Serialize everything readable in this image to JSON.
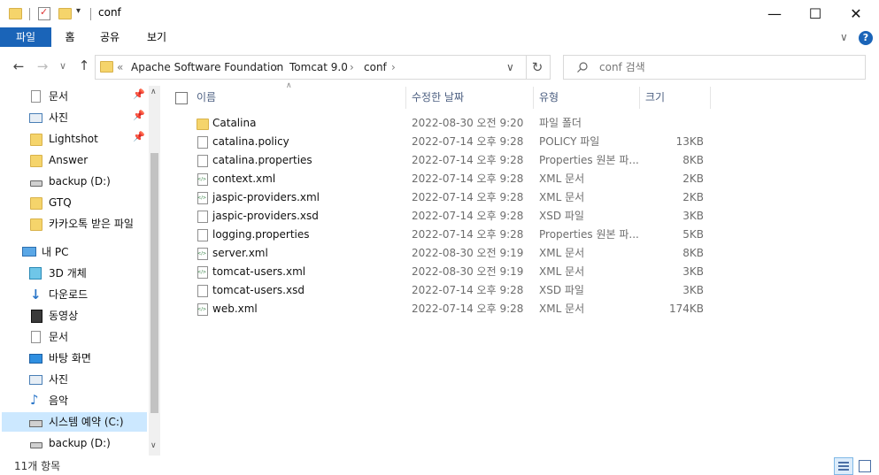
{
  "window": {
    "title": "conf",
    "minimize": "—",
    "maximize": "☐",
    "close": "✕",
    "quick_access_dropdown": "▾"
  },
  "ribbon": {
    "tabs": [
      "파일",
      "홈",
      "공유",
      "보기"
    ],
    "expand_chevron": "∨",
    "help": "?"
  },
  "navigation": {
    "back": "←",
    "forward": "→",
    "history": "∨",
    "up": "↑",
    "address_overflow": "«",
    "breadcrumb": [
      "Apache Software Foundation",
      "Tomcat 9.0",
      "conf"
    ],
    "crumb_separator": "›",
    "address_dropdown": "∨",
    "refresh": "↻",
    "search_placeholder": "conf 검색"
  },
  "sidebar": {
    "items": [
      {
        "label": "문서",
        "icon": "document-icon",
        "pinned": true
      },
      {
        "label": "사진",
        "icon": "pictures-icon",
        "pinned": true
      },
      {
        "label": "Lightshot",
        "icon": "folder-icon",
        "pinned": true
      },
      {
        "label": "Answer",
        "icon": "folder-icon",
        "pinned": false
      },
      {
        "label": "backup (D:)",
        "icon": "drive-icon",
        "pinned": false
      },
      {
        "label": "GTQ",
        "icon": "folder-icon",
        "pinned": false
      },
      {
        "label": "카카오톡 받은 파일",
        "icon": "folder-icon",
        "pinned": false
      },
      {
        "label": "내 PC",
        "icon": "pc-icon",
        "pinned": false
      },
      {
        "label": "3D 개체",
        "icon": "3d-objects-icon",
        "pinned": false
      },
      {
        "label": "다운로드",
        "icon": "download-icon",
        "pinned": false
      },
      {
        "label": "동영상",
        "icon": "video-icon",
        "pinned": false
      },
      {
        "label": "문서",
        "icon": "document-icon",
        "pinned": false
      },
      {
        "label": "바탕 화면",
        "icon": "desktop-icon",
        "pinned": false
      },
      {
        "label": "사진",
        "icon": "pictures-icon",
        "pinned": false
      },
      {
        "label": "음악",
        "icon": "music-icon",
        "pinned": false
      },
      {
        "label": "시스템 예약 (C:)",
        "icon": "system-drive-icon",
        "pinned": false,
        "selected": true
      },
      {
        "label": "backup (D:)",
        "icon": "drive-icon",
        "pinned": false
      }
    ],
    "pin_glyph": "📌",
    "scroll_up": "∧",
    "scroll_down": "∨"
  },
  "columns": {
    "name": "이름",
    "date": "수정한 날짜",
    "type": "유형",
    "size": "크기",
    "sort_indicator": "∧"
  },
  "files": [
    {
      "name": "Catalina",
      "date": "2022-08-30 오전 9:20",
      "type": "파일 폴더",
      "size": "",
      "icon": "folder-icon"
    },
    {
      "name": "catalina.policy",
      "date": "2022-07-14 오후 9:28",
      "type": "POLICY 파일",
      "size": "13KB",
      "icon": "file-icon"
    },
    {
      "name": "catalina.properties",
      "date": "2022-07-14 오후 9:28",
      "type": "Properties 원본 파...",
      "size": "8KB",
      "icon": "file-icon"
    },
    {
      "name": "context.xml",
      "date": "2022-07-14 오후 9:28",
      "type": "XML 문서",
      "size": "2KB",
      "icon": "xml-file-icon"
    },
    {
      "name": "jaspic-providers.xml",
      "date": "2022-07-14 오후 9:28",
      "type": "XML 문서",
      "size": "2KB",
      "icon": "xml-file-icon"
    },
    {
      "name": "jaspic-providers.xsd",
      "date": "2022-07-14 오후 9:28",
      "type": "XSD 파일",
      "size": "3KB",
      "icon": "file-icon"
    },
    {
      "name": "logging.properties",
      "date": "2022-07-14 오후 9:28",
      "type": "Properties 원본 파...",
      "size": "5KB",
      "icon": "file-icon"
    },
    {
      "name": "server.xml",
      "date": "2022-08-30 오전 9:19",
      "type": "XML 문서",
      "size": "8KB",
      "icon": "xml-file-icon"
    },
    {
      "name": "tomcat-users.xml",
      "date": "2022-08-30 오전 9:19",
      "type": "XML 문서",
      "size": "3KB",
      "icon": "xml-file-icon"
    },
    {
      "name": "tomcat-users.xsd",
      "date": "2022-07-14 오후 9:28",
      "type": "XSD 파일",
      "size": "3KB",
      "icon": "file-icon"
    },
    {
      "name": "web.xml",
      "date": "2022-07-14 오후 9:28",
      "type": "XML 문서",
      "size": "174KB",
      "icon": "xml-file-icon"
    }
  ],
  "status": {
    "item_count": "11개 항목"
  },
  "colors": {
    "accent": "#1a64b8",
    "folder": "#f5d46b",
    "selected_nav": "#cce8ff",
    "help_button": "#1a64b8"
  }
}
